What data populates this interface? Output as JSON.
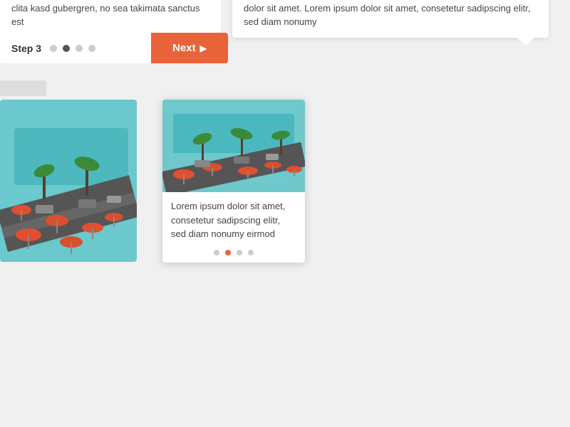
{
  "top_left_text": "accusam et justo duo dolores et ea rebum. Stet clita kasd gubergren, no sea takimata sanctus est",
  "top_right_text": "Stet clita kasd gubergren, no sea takimata sanctus est Lorem ipsum dolor sit amet. Lorem ipsum dolor sit amet, consetetur sadipscing elitr, sed diam nonumy",
  "step": {
    "label": "Step 3",
    "dots": [
      false,
      true,
      false,
      false
    ],
    "next_label": "Next"
  },
  "card2": {
    "text": "Lorem ipsum dolor sit amet, consetetur sadipscing elitr, sed diam nonumy eirmod",
    "dots": [
      false,
      true,
      false,
      false
    ]
  }
}
